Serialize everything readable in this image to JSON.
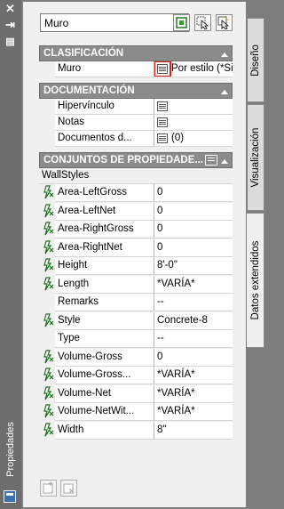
{
  "palette": {
    "title": "Propiedades"
  },
  "toolbar": {
    "type_select_value": "Muro"
  },
  "sections": {
    "clasificacion": {
      "title": "CLASIFICACIÓN",
      "rows": [
        {
          "name": "Muro",
          "value": "Por estilo (*Si..."
        }
      ]
    },
    "documentacion": {
      "title": "DOCUMENTACIÓN",
      "rows": [
        {
          "name": "Hipervínculo",
          "value": ""
        },
        {
          "name": "Notas",
          "value": ""
        },
        {
          "name": "Documentos d...",
          "value": "(0)"
        }
      ]
    },
    "conjuntos": {
      "title": "CONJUNTOS DE PROPIEDADE...",
      "group": "WallStyles",
      "rows": [
        {
          "name": "Area-LeftGross",
          "value": "0"
        },
        {
          "name": "Area-LeftNet",
          "value": "0"
        },
        {
          "name": "Area-RightGross",
          "value": "0"
        },
        {
          "name": "Area-RightNet",
          "value": "0"
        },
        {
          "name": "Height",
          "value": "8'-0\""
        },
        {
          "name": "Length",
          "value": "*VARÍA*"
        },
        {
          "name": "Remarks",
          "value": "--"
        },
        {
          "name": "Style",
          "value": "Concrete-8"
        },
        {
          "name": "Type",
          "value": "--"
        },
        {
          "name": "Volume-Gross",
          "value": "0"
        },
        {
          "name": "Volume-Gross...",
          "value": "*VARÍA*"
        },
        {
          "name": "Volume-Net",
          "value": "*VARÍA*"
        },
        {
          "name": "Volume-NetWit...",
          "value": "*VARÍA*"
        },
        {
          "name": "Width",
          "value": "8\""
        }
      ]
    }
  },
  "tabs": [
    "Diseño",
    "Visualización",
    "Datos extendidos"
  ],
  "colors": {
    "highlight": "#e02020",
    "section_header": "#8b8b8b",
    "panel": "#f0f0f0"
  }
}
